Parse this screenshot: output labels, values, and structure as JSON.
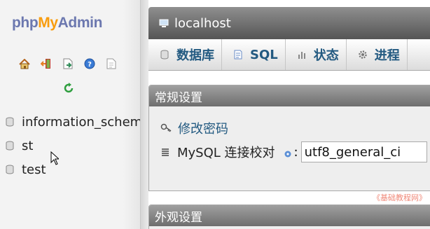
{
  "logo": {
    "php": "php",
    "my": "My",
    "admin": "Admin"
  },
  "nav_icons": [
    "home-icon",
    "exit-icon",
    "query-window-icon",
    "docs-help-icon",
    "documentation-icon"
  ],
  "nav_reload_icon": "reload-icon",
  "databases": [
    {
      "name": "information_schema"
    },
    {
      "name": "st"
    },
    {
      "name": "test"
    }
  ],
  "server": {
    "name": "localhost"
  },
  "tabs": [
    {
      "label": "数据库",
      "icon": "database-icon"
    },
    {
      "label": "SQL",
      "icon": "sql-icon"
    },
    {
      "label": "状态",
      "icon": "status-icon"
    },
    {
      "label": "进程",
      "icon": "gear-icon"
    }
  ],
  "general_settings": {
    "title": "常规设置",
    "change_password": "修改密码",
    "collation_label": "MySQL 连接校对",
    "colon": ":",
    "collation_value": "utf8_general_ci"
  },
  "appearance_settings": {
    "title": "外观设置"
  },
  "watermark": "《基础教程网》",
  "colors": {
    "link": "#235a81",
    "logo_orange": "#f89c0e",
    "logo_blue": "#6c78af",
    "header_dark": "#555555"
  }
}
